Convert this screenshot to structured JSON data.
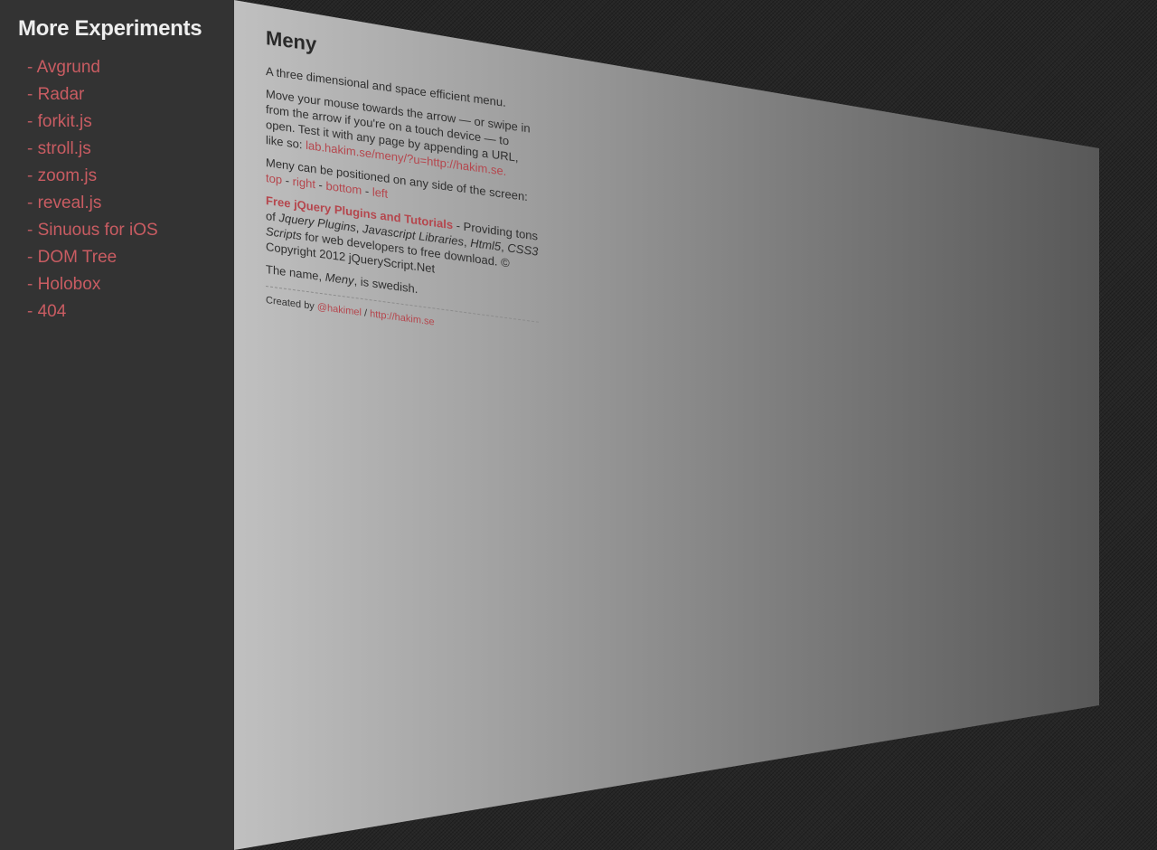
{
  "sidebar": {
    "title": "More Experiments",
    "dash": "-",
    "items": [
      {
        "label": "Avgrund"
      },
      {
        "label": "Radar"
      },
      {
        "label": "forkit.js"
      },
      {
        "label": "stroll.js"
      },
      {
        "label": "zoom.js"
      },
      {
        "label": "reveal.js"
      },
      {
        "label": "Sinuous for iOS"
      },
      {
        "label": "DOM Tree"
      },
      {
        "label": "Holobox"
      },
      {
        "label": "404"
      }
    ]
  },
  "page": {
    "title": "Meny",
    "tagline": "A three dimensional and space efficient menu.",
    "instructions": "Move your mouse towards the arrow — or swipe in from the arrow if you're on a touch device — to open. Test it with any page by appending a URL, like so:",
    "example_link": "lab.hakim.se/meny/?u=http://hakim.se.",
    "position_text": "Meny can be positioned on any side of the screen:",
    "separator": " - ",
    "positions": [
      "top",
      "right",
      "bottom",
      "left"
    ],
    "promo": {
      "link": "Free jQuery Plugins and Tutorials",
      "text_1": " - Providing tons of ",
      "italic_1": "Jquery Plugins",
      "comma_1": ", ",
      "italic_2": "Javascript Libraries",
      "comma_2": ", ",
      "italic_3": "Html5",
      "comma_3": ", ",
      "italic_4": "CSS3 Scripts",
      "text_2": " for web developers to free download. © Copyright 2012 jQueryScript.Net"
    },
    "name_note": {
      "before": "The name, ",
      "italic": "Meny",
      "after": ", is swedish."
    },
    "footer": {
      "prefix": "Created by ",
      "twitter": "@hakimel",
      "divider": " / ",
      "site": "http://hakim.se"
    }
  },
  "colors": {
    "sidebar_bg": "#333333",
    "sidebar_title": "#eeeeee",
    "link_accent": "#c95c62",
    "page_accent": "#b5464d"
  }
}
